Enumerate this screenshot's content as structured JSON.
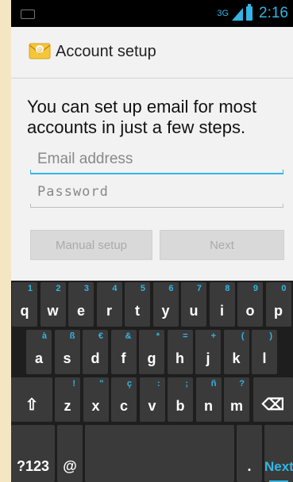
{
  "status_bar": {
    "network": "3G",
    "time": "2:16"
  },
  "app": {
    "title": "Account setup",
    "intro": "You can set up email for most accounts in just a few steps.",
    "email_placeholder": "Email address",
    "password_placeholder": "Password",
    "manual_button": "Manual setup",
    "next_button": "Next"
  },
  "keyboard": {
    "row1": [
      {
        "label": "q",
        "hint": "1"
      },
      {
        "label": "w",
        "hint": "2"
      },
      {
        "label": "e",
        "hint": "3"
      },
      {
        "label": "r",
        "hint": "4"
      },
      {
        "label": "t",
        "hint": "5"
      },
      {
        "label": "y",
        "hint": "6"
      },
      {
        "label": "u",
        "hint": "7"
      },
      {
        "label": "i",
        "hint": "8"
      },
      {
        "label": "o",
        "hint": "9"
      },
      {
        "label": "p",
        "hint": "0"
      }
    ],
    "row2": [
      {
        "label": "a",
        "hint": "à"
      },
      {
        "label": "s",
        "hint": "ß"
      },
      {
        "label": "d",
        "hint": "€"
      },
      {
        "label": "f",
        "hint": "&"
      },
      {
        "label": "g",
        "hint": "*"
      },
      {
        "label": "h",
        "hint": "="
      },
      {
        "label": "j",
        "hint": "+"
      },
      {
        "label": "k",
        "hint": "("
      },
      {
        "label": "l",
        "hint": ")"
      }
    ],
    "row3": [
      {
        "label": "z",
        "hint": "!"
      },
      {
        "label": "x",
        "hint": "\""
      },
      {
        "label": "c",
        "hint": "ç"
      },
      {
        "label": "v",
        "hint": ":"
      },
      {
        "label": "b",
        "hint": ";"
      },
      {
        "label": "n",
        "hint": "ñ"
      },
      {
        "label": "m",
        "hint": "?"
      }
    ],
    "shift_label": "⇧",
    "delete_label": "⌫",
    "symbols_label": "?123",
    "at_label": "@",
    "space_label": "",
    "period_label": ".",
    "next_label": "Next"
  },
  "colors": {
    "accent": "#33b5e5",
    "keyboard_bg": "#1e1e1e",
    "key_bg": "#3a3a3a",
    "app_bg": "#f2f2f2"
  }
}
